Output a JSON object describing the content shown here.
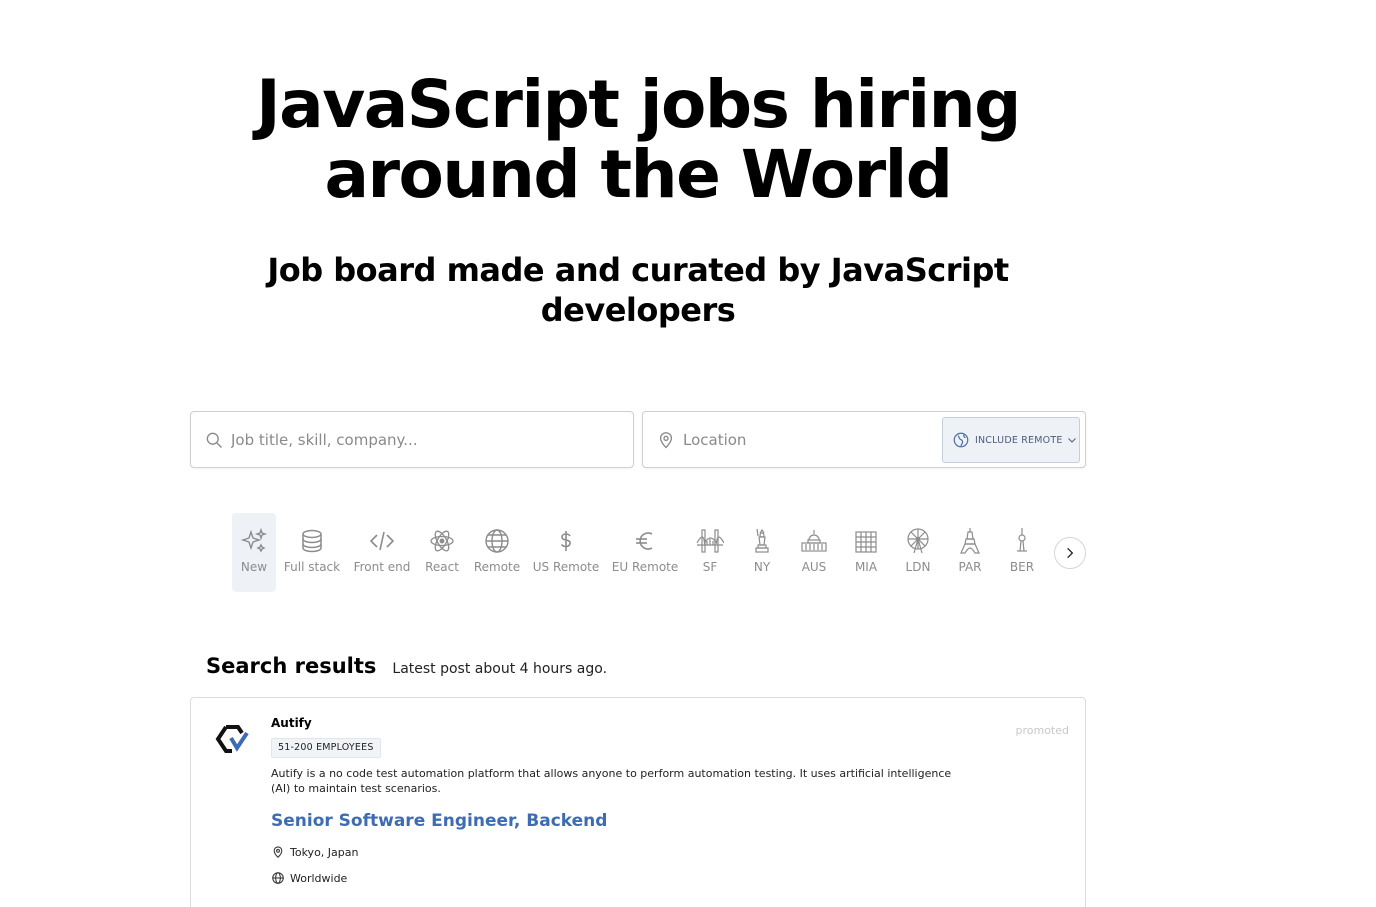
{
  "hero": {
    "title": "JavaScript jobs hiring around the World",
    "subtitle": "Job board made and curated by JavaScript developers"
  },
  "search": {
    "keyword_placeholder": "Job title, skill, company...",
    "location_placeholder": "Location",
    "remote_button_label": "INCLUDE REMOTE"
  },
  "categories": [
    {
      "label": "New",
      "icon": "sparkles-icon",
      "active": true
    },
    {
      "label": "Full stack",
      "icon": "database-icon"
    },
    {
      "label": "Front end",
      "icon": "code-icon"
    },
    {
      "label": "React",
      "icon": "atom-icon"
    },
    {
      "label": "Remote",
      "icon": "globe-icon"
    },
    {
      "label": "US Remote",
      "icon": "dollar-icon"
    },
    {
      "label": "EU Remote",
      "icon": "euro-icon"
    },
    {
      "label": "SF",
      "icon": "golden-gate-icon"
    },
    {
      "label": "NY",
      "icon": "statue-of-liberty-icon"
    },
    {
      "label": "AUS",
      "icon": "capitol-icon"
    },
    {
      "label": "MIA",
      "icon": "building-icon"
    },
    {
      "label": "LDN",
      "icon": "london-eye-icon"
    },
    {
      "label": "PAR",
      "icon": "eiffel-tower-icon"
    },
    {
      "label": "BER",
      "icon": "tv-tower-icon"
    }
  ],
  "results": {
    "title": "Search results",
    "subtitle": "Latest post about 4 hours ago."
  },
  "jobs": [
    {
      "company": "Autify",
      "size": "51-200 EMPLOYEES",
      "promoted": "promoted",
      "description": "Autify is a no code test automation platform that allows anyone to perform automation testing. It uses artificial intelligence (AI) to maintain test scenarios.",
      "title": "Senior Software Engineer, Backend",
      "location": "Tokyo, Japan",
      "remote": "Worldwide"
    }
  ],
  "colors": {
    "link": "#3d6cb5",
    "muted": "#8c8c8c",
    "active_bg": "#eef1f5"
  }
}
